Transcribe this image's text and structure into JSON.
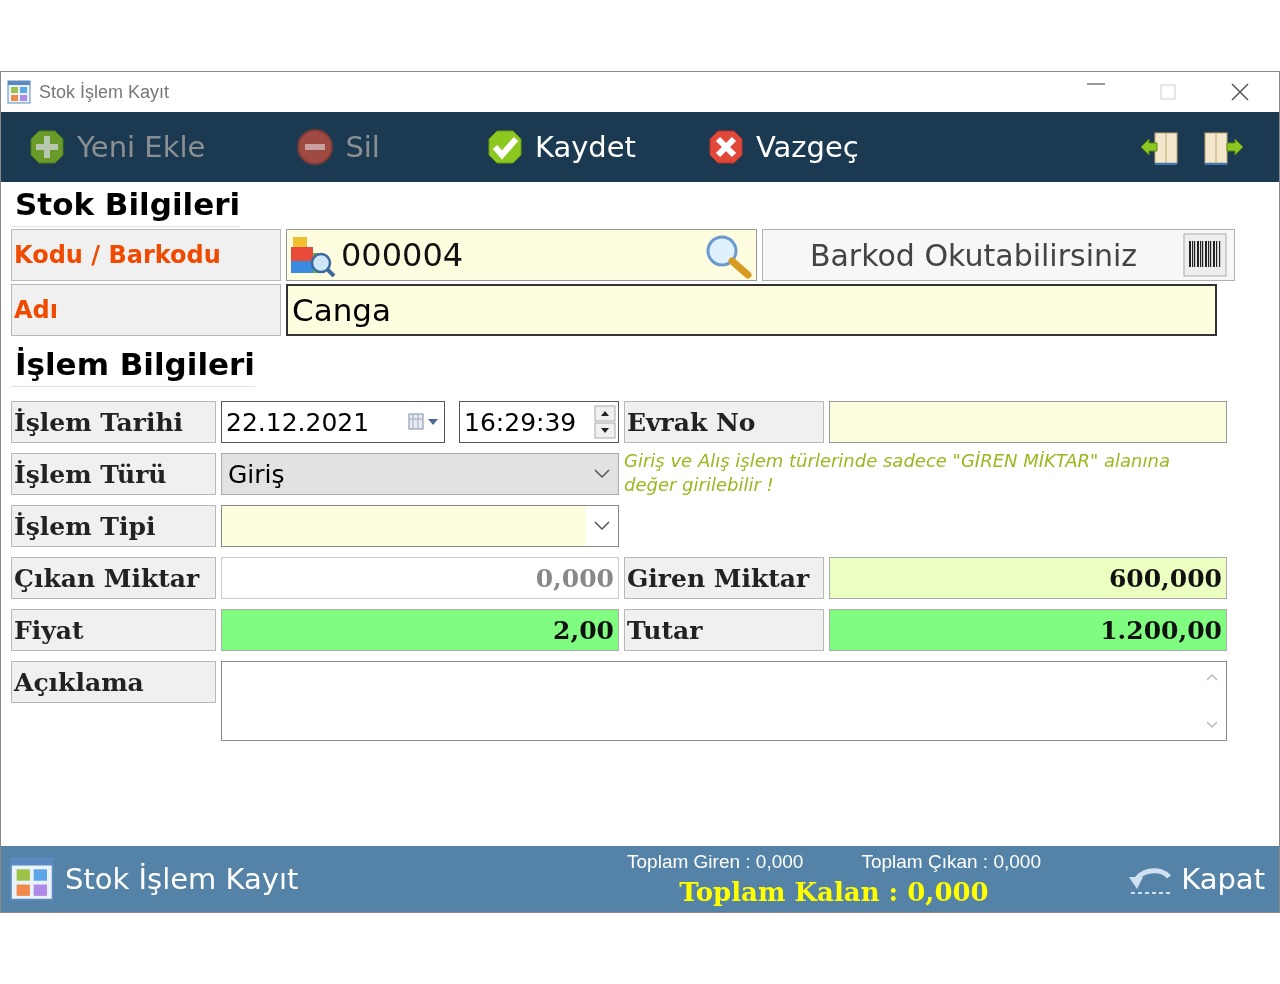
{
  "window": {
    "title": "Stok İşlem Kayıt"
  },
  "toolbar": {
    "buttons": [
      {
        "label": "Yeni Ekle",
        "kind": "add",
        "disabled": true
      },
      {
        "label": "Sil",
        "kind": "delete",
        "disabled": true
      },
      {
        "label": "Kaydet",
        "kind": "save",
        "disabled": false
      },
      {
        "label": "Vazgeç",
        "kind": "cancel",
        "disabled": false
      }
    ]
  },
  "stock": {
    "title": "Stok Bilgileri",
    "code": {
      "label": "Kodu / Barkodu",
      "value": "000004"
    },
    "barcode": {
      "placeholder": "Barkod Okutabilirsiniz"
    },
    "name": {
      "label": "Adı",
      "value": "Canga"
    }
  },
  "process": {
    "title": "İşlem Bilgileri",
    "date": {
      "label": "İşlem Tarihi",
      "value": "22.12.2021",
      "time": "16:29:39"
    },
    "document_no": {
      "label": "Evrak No"
    },
    "type": {
      "label": "İşlem Türü",
      "value": "Giriş",
      "disabled": true
    },
    "hint": "Giriş ve Alış işlem türlerinde sadece \"GİREN MİKTAR\" alanına değer girilebilir !",
    "subtype": {
      "label": "İşlem Tipi"
    },
    "out_qty": {
      "label": "Çıkan Miktar",
      "value": "0,000",
      "disabled": true
    },
    "in_qty": {
      "label": "Giren Miktar",
      "value": "600,000",
      "disabled": false
    },
    "price": {
      "label": "Fiyat",
      "value": "2,00"
    },
    "total": {
      "label": "Tutar",
      "value": "1.200,00"
    },
    "note": {
      "label": "Açıklama"
    }
  },
  "footer": {
    "title": "Stok İşlem Kayıt",
    "total_in": "Toplam Giren : 0,000",
    "total_out": "Toplam Çıkan : 0,000",
    "total_remaining": "Toplam Kalan : 0,000",
    "close_button": "Kapat"
  }
}
